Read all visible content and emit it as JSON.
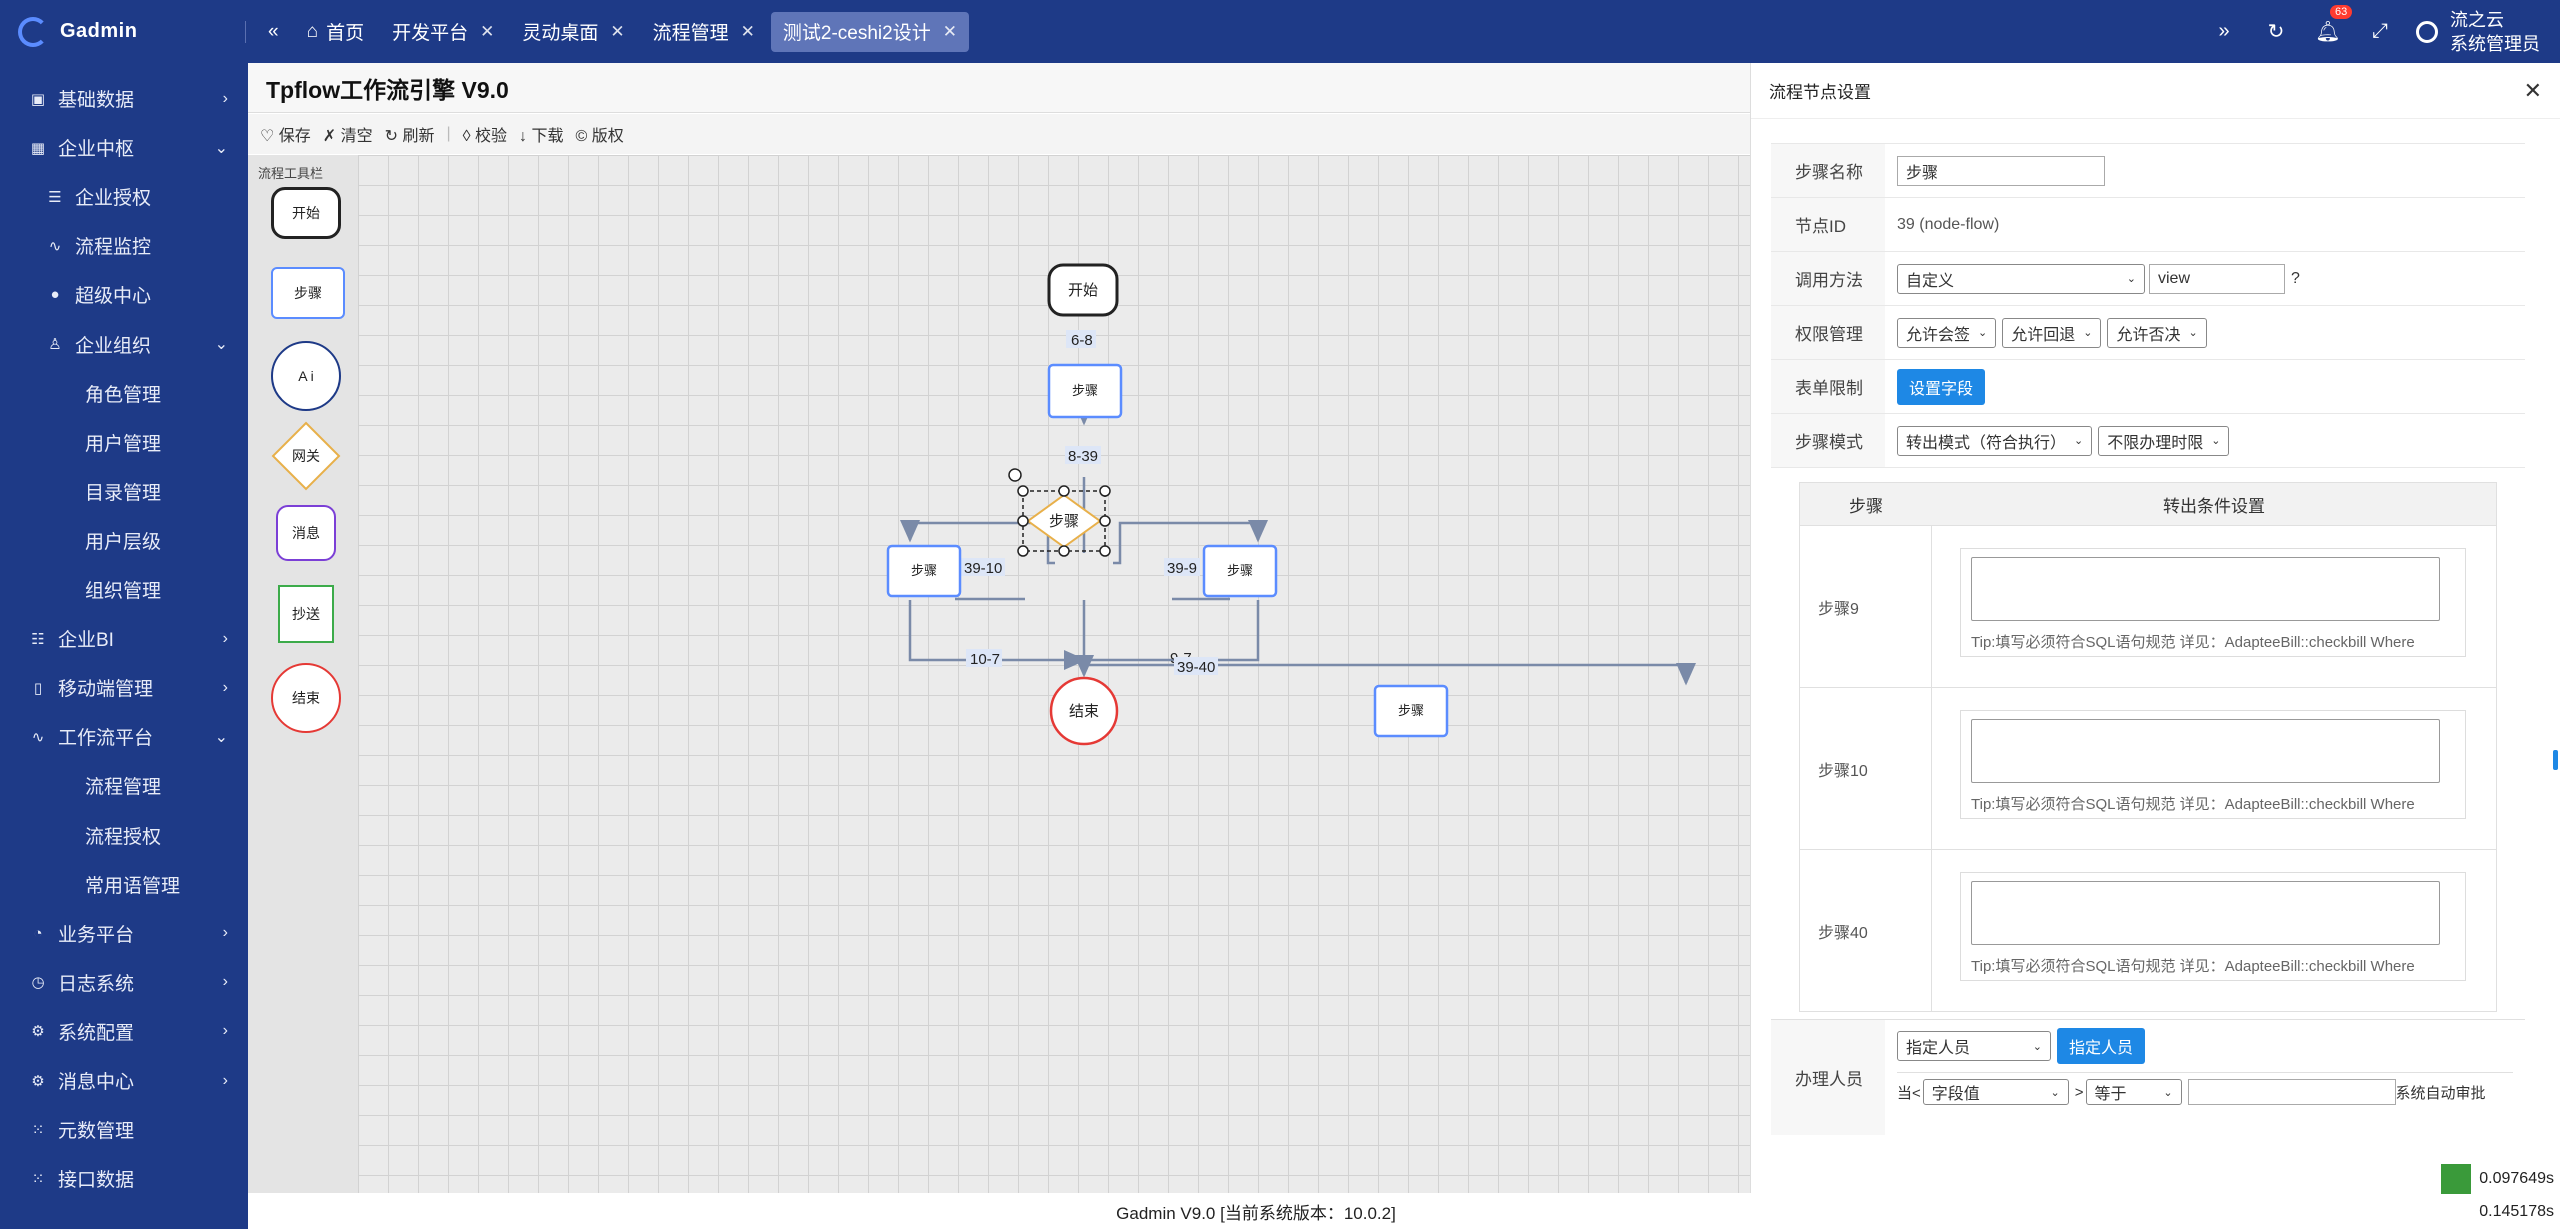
{
  "app": {
    "name": "Gadmin"
  },
  "tabs": [
    {
      "label": "首页",
      "closable": false,
      "active": false
    },
    {
      "label": "开发平台",
      "closable": true,
      "active": false
    },
    {
      "label": "灵动桌面",
      "closable": true,
      "active": false
    },
    {
      "label": "流程管理",
      "closable": true,
      "active": false
    },
    {
      "label": "测试2-ceshi2设计",
      "closable": true,
      "active": true
    }
  ],
  "topright": {
    "notification_count": "63",
    "user_line1": "流之云",
    "user_line2": "系统管理员"
  },
  "sidebar": {
    "items": [
      {
        "label": "基础数据",
        "icon": "database-icon",
        "level": 1,
        "chevron": "›"
      },
      {
        "label": "企业中枢",
        "icon": "grid-icon",
        "level": 1,
        "chevron": "⌄"
      },
      {
        "label": "企业授权",
        "icon": "sliders-icon",
        "level": 2,
        "chevron": ""
      },
      {
        "label": "流程监控",
        "icon": "pulse-icon",
        "level": 2,
        "chevron": ""
      },
      {
        "label": "超级中心",
        "icon": "drop-icon",
        "level": 2,
        "chevron": ""
      },
      {
        "label": "企业组织",
        "icon": "user-icon",
        "level": 2,
        "chevron": "⌄"
      },
      {
        "label": "角色管理",
        "icon": "",
        "level": 3,
        "chevron": ""
      },
      {
        "label": "用户管理",
        "icon": "",
        "level": 3,
        "chevron": ""
      },
      {
        "label": "目录管理",
        "icon": "",
        "level": 3,
        "chevron": ""
      },
      {
        "label": "用户层级",
        "icon": "",
        "level": 3,
        "chevron": ""
      },
      {
        "label": "组织管理",
        "icon": "",
        "level": 3,
        "chevron": ""
      },
      {
        "label": "企业BI",
        "icon": "list-icon",
        "level": 1,
        "chevron": "›"
      },
      {
        "label": "移动端管理",
        "icon": "mobile-icon",
        "level": 1,
        "chevron": "›"
      },
      {
        "label": "工作流平台",
        "icon": "pulse-icon",
        "level": 1,
        "chevron": "⌄"
      },
      {
        "label": "流程管理",
        "icon": "",
        "level": 3,
        "chevron": ""
      },
      {
        "label": "流程授权",
        "icon": "",
        "level": 3,
        "chevron": ""
      },
      {
        "label": "常用语管理",
        "icon": "",
        "level": 3,
        "chevron": ""
      },
      {
        "label": "业务平台",
        "icon": "cycle-icon",
        "level": 1,
        "chevron": "›"
      },
      {
        "label": "日志系统",
        "icon": "clock-icon",
        "level": 1,
        "chevron": "›"
      },
      {
        "label": "系统配置",
        "icon": "gear-icon",
        "level": 1,
        "chevron": "›"
      },
      {
        "label": "消息中心",
        "icon": "gear-icon",
        "level": 1,
        "chevron": "›"
      },
      {
        "label": "元数管理",
        "icon": "dots-icon",
        "level": 1,
        "chevron": ""
      },
      {
        "label": "接口数据",
        "icon": "dots-icon",
        "level": 1,
        "chevron": ""
      }
    ]
  },
  "designer": {
    "title": "Tpflow工作流引擎 V9.0",
    "toolbar": [
      "♡ 保存",
      "✗ 清空",
      "↻ 刷新",
      "◊ 校验",
      "↓ 下载",
      "© 版权"
    ],
    "palette_title": "流程工具栏",
    "palette": [
      "开始",
      "步骤",
      "A i",
      "网关",
      "消息",
      "抄送",
      "结束"
    ],
    "nodes": {
      "start": "开始",
      "step": "步骤",
      "selected": "步骤",
      "left": "步骤",
      "right": "步骤",
      "end": "结束",
      "far": "步骤"
    },
    "edges": {
      "e1": "6-8",
      "e2": "8-39",
      "e3": "39-10",
      "e4": "39-9",
      "e5": "10-7",
      "e6": "9-7",
      "e7": "39-40"
    }
  },
  "panel": {
    "title": "流程节点设置",
    "step_name_label": "步骤名称",
    "step_name_value": "步骤",
    "node_id_label": "节点ID",
    "node_id_value": "39  (node-flow)",
    "call_label": "调用方法",
    "call_select": "自定义",
    "call_input": "view",
    "call_help": "?",
    "perm_label": "权限管理",
    "perm1": "允许会签",
    "perm2": "允许回退",
    "perm3": "允许否决",
    "form_label": "表单限制",
    "form_button": "设置字段",
    "mode_label": "步骤模式",
    "mode1": "转出模式（符合执行）",
    "mode2": "不限办理时限",
    "cond_col1": "步骤",
    "cond_col2": "转出条件设置",
    "conditions": [
      {
        "step": "步骤9",
        "tip": "Tip:填写必须符合SQL语句规范 详见：AdapteeBill::checkbill Where"
      },
      {
        "step": "步骤10",
        "tip": "Tip:填写必须符合SQL语句规范 详见：AdapteeBill::checkbill Where"
      },
      {
        "step": "步骤40",
        "tip": "Tip:填写必须符合SQL语句规范 详见：AdapteeBill::checkbill Where"
      }
    ],
    "handler_label": "办理人员",
    "handler_select": "指定人员",
    "handler_button": "指定人员",
    "when_label": "当<",
    "field_select": "字段值",
    "gt": ">",
    "op_select": "等于",
    "auto_text": "系统自动审批"
  },
  "footer": {
    "version": "Gadmin V9.0 [当前系统版本：10.0.2]"
  },
  "timer": {
    "t1": "0.097649s",
    "t2": "0.145178s"
  },
  "colors": {
    "primary": "#1e3a87",
    "accent": "#1e88e5",
    "step_border": "#5b8cff",
    "end_border": "#e53935"
  }
}
